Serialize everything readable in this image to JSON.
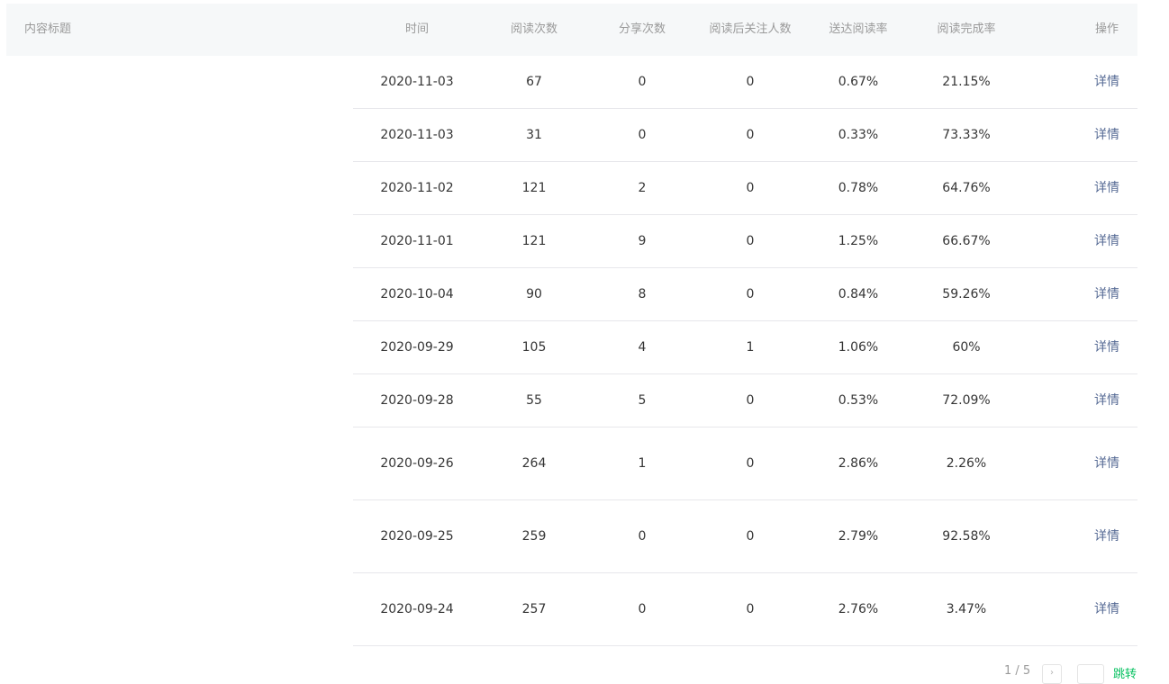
{
  "table": {
    "headers": {
      "title": "内容标题",
      "time": "时间",
      "reads": "阅读次数",
      "shares": "分享次数",
      "follows": "阅读后关注人数",
      "delivery_rate": "送达阅读率",
      "completion_rate": "阅读完成率",
      "action": "操作"
    },
    "rows": [
      {
        "time": "2020-11-03",
        "reads": "67",
        "shares": "0",
        "follows": "0",
        "delivery_rate": "0.67%",
        "completion_rate": "21.15%",
        "action": "详情"
      },
      {
        "time": "2020-11-03",
        "reads": "31",
        "shares": "0",
        "follows": "0",
        "delivery_rate": "0.33%",
        "completion_rate": "73.33%",
        "action": "详情"
      },
      {
        "time": "2020-11-02",
        "reads": "121",
        "shares": "2",
        "follows": "0",
        "delivery_rate": "0.78%",
        "completion_rate": "64.76%",
        "action": "详情"
      },
      {
        "time": "2020-11-01",
        "reads": "121",
        "shares": "9",
        "follows": "0",
        "delivery_rate": "1.25%",
        "completion_rate": "66.67%",
        "action": "详情"
      },
      {
        "time": "2020-10-04",
        "reads": "90",
        "shares": "8",
        "follows": "0",
        "delivery_rate": "0.84%",
        "completion_rate": "59.26%",
        "action": "详情"
      },
      {
        "time": "2020-09-29",
        "reads": "105",
        "shares": "4",
        "follows": "1",
        "delivery_rate": "1.06%",
        "completion_rate": "60%",
        "action": "详情"
      },
      {
        "time": "2020-09-28",
        "reads": "55",
        "shares": "5",
        "follows": "0",
        "delivery_rate": "0.53%",
        "completion_rate": "72.09%",
        "action": "详情"
      },
      {
        "time": "2020-09-26",
        "reads": "264",
        "shares": "1",
        "follows": "0",
        "delivery_rate": "2.86%",
        "completion_rate": "2.26%",
        "action": "详情"
      },
      {
        "time": "2020-09-25",
        "reads": "259",
        "shares": "0",
        "follows": "0",
        "delivery_rate": "2.79%",
        "completion_rate": "92.58%",
        "action": "详情"
      },
      {
        "time": "2020-09-24",
        "reads": "257",
        "shares": "0",
        "follows": "0",
        "delivery_rate": "2.76%",
        "completion_rate": "3.47%",
        "action": "详情"
      }
    ]
  },
  "pagination": {
    "page_indicator": "1 / 5",
    "next_symbol": "›",
    "jump_label": "跳转"
  }
}
